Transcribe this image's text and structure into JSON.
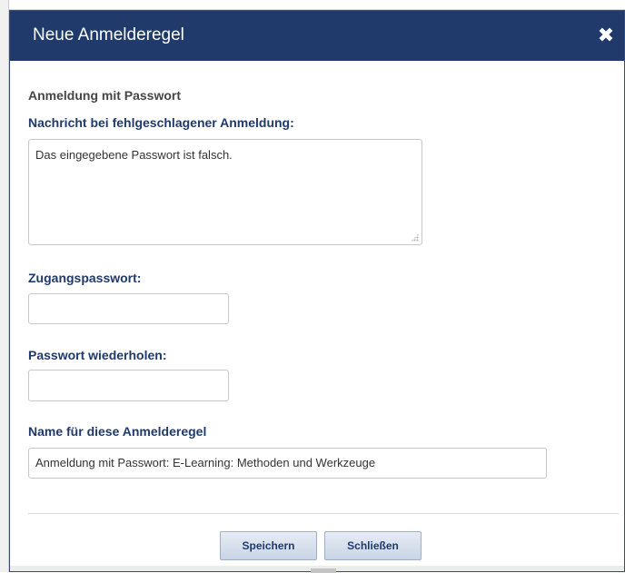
{
  "dialog": {
    "title": "Neue Anmelderegel",
    "close_icon": "✖"
  },
  "form": {
    "section_title": "Anmeldung mit Passwort",
    "failure_message_label": "Nachricht bei fehlgeschlagener Anmeldung:",
    "failure_message_value": "Das eingegebene Passwort ist falsch.",
    "password_label": "Zugangspasswort:",
    "password_value": "",
    "repeat_password_label": "Passwort wiederholen:",
    "repeat_password_value": "",
    "rule_name_label": "Name für diese Anmelderegel",
    "rule_name_value": "Anmeldung mit Passwort: E-Learning: Methoden und Werkzeuge"
  },
  "buttons": {
    "save_label": "Speichern",
    "close_label": "Schließen"
  },
  "colors": {
    "titlebar": "#1f3a6b",
    "label_accent": "#1f3a6b"
  }
}
